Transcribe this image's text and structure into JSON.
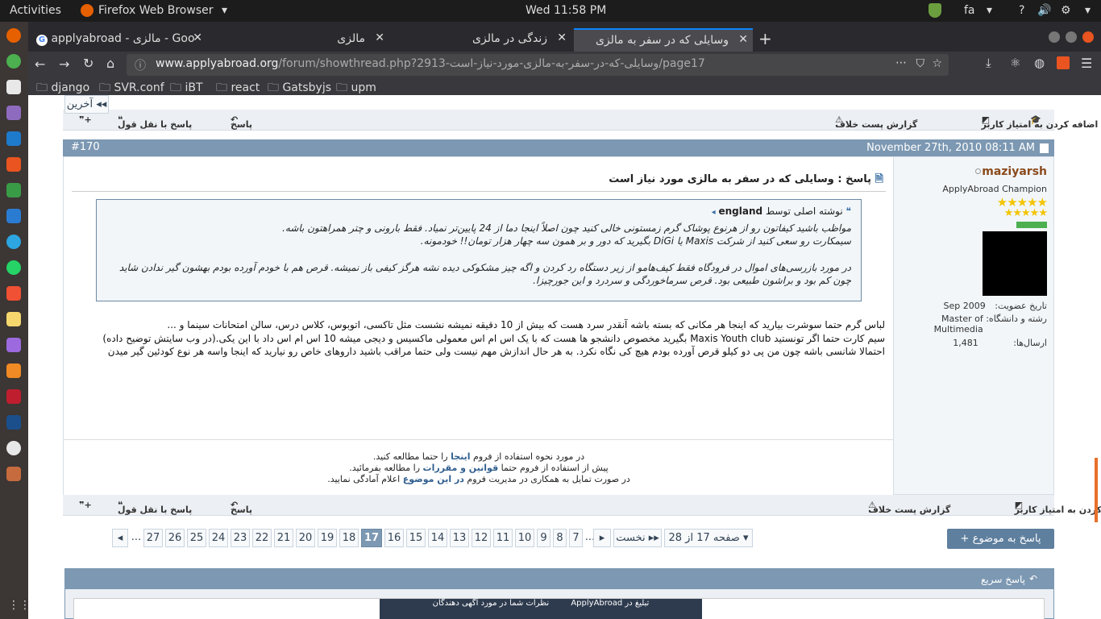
{
  "system": {
    "activities": "Activities",
    "app_name": "Firefox Web Browser",
    "clock": "Wed 11:58 PM",
    "lang": "fa",
    "help": "?"
  },
  "tabs": [
    {
      "title": "applyabroad - مالزی - Goo"
    },
    {
      "title": "مالزی"
    },
    {
      "title": "زندگی در مالزی"
    },
    {
      "title": "وسایلی که در سفر به مالزی"
    }
  ],
  "url": {
    "domain": "www.applyabroad.org",
    "path": "/forum/showthread.php?2913-وسایلی-که-در-سفر-به-مالزی-مورد-نیاز-است/page17"
  },
  "bookmarks": [
    "django",
    "SVR.conf",
    "iBT",
    "react",
    "Gatsbyjs",
    "upm"
  ],
  "actions": {
    "add_rep": "اضافه کردن به امتیاز کاربر",
    "report": "گزارش پست خلاف",
    "reply": "پاسخ",
    "quote_reply": "پاسخ با نقل قول"
  },
  "post": {
    "number": "#170",
    "date": "November 27th, 2010 08:11 AM",
    "title": "پاسخ : وسایلی که در سفر به مالزی مورد نیاز است",
    "quote_author_prefix": "نوشته اصلی توسط",
    "quote_author": "england",
    "quote_lines": [
      "مواظب باشید کیفاتون رو از هرنوع پوشاک گرم زمستونی خالی کنید چون اصلاً اینجا دما از 24 پایین‌تر نمیاد. فقط بارونی و چتر همراهتون باشه.",
      "سیمکارت رو سعی کنید از شرکت Maxis یا DiGi بگیرید که دور و بر همون سه چهار هزار تومان!! خودمونه.",
      "",
      "در مورد بازرسی‌های اموال در فرودگاه فقط کیف‌هامو از زیر دستگاه رد کردن و اگه چیز مشکوکی دیده نشه هرگز کیفی باز نمیشه. قرص هم با خودم آورده بودم بهشون گیر ندادن شاید چون کم بود و براشون طبیعی بود. قرص سرماخوردگی و سردرد و این جورچیزا."
    ],
    "message_lines": [
      "لباس گرم حتما سوشرت بیارید که اینجا هر مکانی که بسته باشه آنقدر سرد هست که بیش از 10 دقیقه نمیشه نشست مثل تاکسی، اتوبوس، کلاس درس، سالن امتحانات سینما و ...",
      "سیم کارت حتما اگر تونستید Maxis Youth club بگیرید مخصوص دانشجو ها هست که با یک اس ام اس معمولی ماکسیس و دیجی میشه 10 اس ام اس داد با این یکی.(در وب سایتش توضیح داده)",
      "احتمالا شانسی باشه چون من پی دو کیلو قرص آورده بودم هیچ کی نگاه نکرد. به هر حال اندازش مهم نیست ولی حتما مراقب باشید داروهای خاص رو نیارید که اینجا واسه هر نوع کودئین گیر میدن"
    ]
  },
  "user": {
    "name": "maziyarsh",
    "rank": "ApplyAbroad Champion",
    "join_label": "تاریخ عضویت:",
    "join_value": "Sep 2009",
    "field_label": "رشته و دانشگاه:",
    "field_value": "Master of Multimedia",
    "posts_label": "ارسال‌ها:",
    "posts_value": "1,481"
  },
  "signature": {
    "l1a": "در مورد نحوه استفاده از فروم",
    "l1b": "اینجا",
    "l1c": "را حتما مطالعه کنید.",
    "l2a": "پیش از استفاده از فروم حتما",
    "l2b": "قوانین و مقررات",
    "l2c": "را مطالعه بفرمائید.",
    "l3a": "در صورت تمایل به همکاری در مدیریت فروم",
    "l3b": "در این موضوع",
    "l3c": "اعلام آمادگی نمایید."
  },
  "pagination": {
    "last": "آخرین",
    "first": "نخست",
    "page_of": "صفحه 17 از 28",
    "pages_high": [
      "27",
      "26",
      "25",
      "24",
      "23",
      "22",
      "21",
      "20",
      "19",
      "18"
    ],
    "current": "17",
    "pages_low": [
      "16",
      "15",
      "14",
      "13",
      "12",
      "11",
      "10",
      "9",
      "8",
      "7"
    ],
    "ellipsis": "..."
  },
  "reply_topic": "+ پاسخ به موضوع",
  "quick_reply": "پاسخ سریع",
  "ad": {
    "left": "نظرات شما در مورد آگهی دهندگان",
    "right": "تبلیغ در ApplyAbroad"
  },
  "colors": {
    "accent": "#7c98b2",
    "username": "#8a4a1c",
    "tab_active_border": "#0a84ff"
  }
}
